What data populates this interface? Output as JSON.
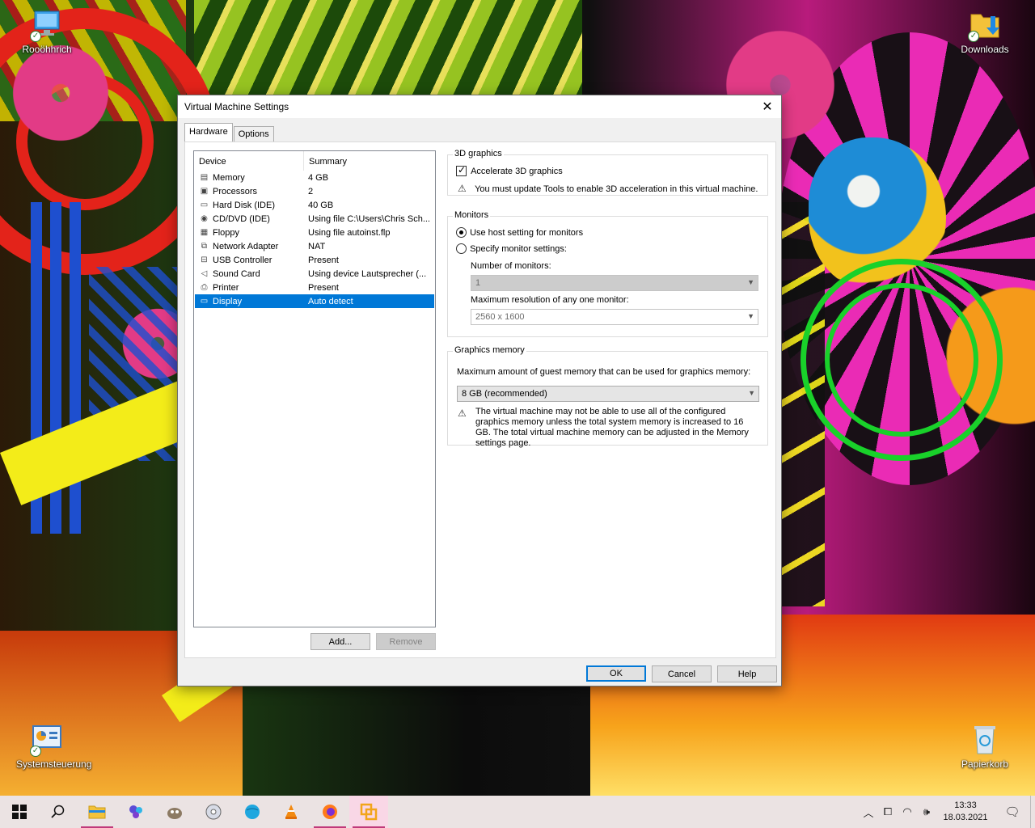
{
  "desktop": {
    "icons": [
      {
        "label": "Rooöhhrich",
        "icon": "computer-icon"
      },
      {
        "label": "Downloads",
        "icon": "downloads-folder-icon"
      },
      {
        "label": "Systemsteuerung",
        "icon": "control-panel-icon"
      },
      {
        "label": "Papierkorb",
        "icon": "recycle-bin-icon"
      }
    ]
  },
  "dialog": {
    "title": "Virtual Machine Settings",
    "tabs": [
      {
        "label": "Hardware"
      },
      {
        "label": "Options"
      }
    ],
    "device_list": {
      "col_device": "Device",
      "col_summary": "Summary",
      "rows": [
        {
          "device": "Memory",
          "summary": "4 GB",
          "icon": "memory-icon"
        },
        {
          "device": "Processors",
          "summary": "2",
          "icon": "processor-icon"
        },
        {
          "device": "Hard Disk (IDE)",
          "summary": "40 GB",
          "icon": "hard-disk-icon"
        },
        {
          "device": "CD/DVD (IDE)",
          "summary": "Using file C:\\Users\\Chris Sch...",
          "icon": "cd-dvd-icon"
        },
        {
          "device": "Floppy",
          "summary": "Using file autoinst.flp",
          "icon": "floppy-icon"
        },
        {
          "device": "Network Adapter",
          "summary": "NAT",
          "icon": "network-adapter-icon"
        },
        {
          "device": "USB Controller",
          "summary": "Present",
          "icon": "usb-controller-icon"
        },
        {
          "device": "Sound Card",
          "summary": "Using device Lautsprecher (...",
          "icon": "sound-card-icon"
        },
        {
          "device": "Printer",
          "summary": "Present",
          "icon": "printer-icon"
        },
        {
          "device": "Display",
          "summary": "Auto detect",
          "icon": "display-icon"
        }
      ],
      "selected": "Display"
    },
    "add_label": "Add...",
    "remove_label": "Remove",
    "graphics3d": {
      "legend": "3D graphics",
      "accelerate_label": "Accelerate 3D graphics",
      "accelerate_checked": true,
      "warning": "You must update Tools to enable 3D acceleration in this virtual machine."
    },
    "monitors": {
      "legend": "Monitors",
      "use_host_label": "Use host setting for monitors",
      "specify_label": "Specify monitor settings:",
      "selected_option": "use_host",
      "num_monitors_label": "Number of monitors:",
      "num_monitors_value": "1",
      "max_res_label": "Maximum resolution of any one monitor:",
      "max_res_value": "2560 x 1600"
    },
    "graphics_memory": {
      "legend": "Graphics memory",
      "label": "Maximum amount of guest memory that can be used for graphics memory:",
      "value": "8 GB (recommended)",
      "warning": "The virtual machine may not be able to use all of the configured graphics memory unless the total system memory is increased to 16 GB. The total virtual machine memory can be adjusted in the Memory settings page."
    },
    "ok_label": "OK",
    "cancel_label": "Cancel",
    "help_label": "Help"
  },
  "taskbar": {
    "apps": [
      {
        "name": "start-button",
        "icon": "windows-logo-icon"
      },
      {
        "name": "search-button",
        "icon": "search-icon"
      },
      {
        "name": "file-explorer",
        "icon": "folder-icon"
      },
      {
        "name": "app-chameleon",
        "icon": "chameleon-app-icon"
      },
      {
        "name": "app-gimp",
        "icon": "gimp-icon"
      },
      {
        "name": "app-disc",
        "icon": "disc-burner-icon"
      },
      {
        "name": "app-globe",
        "icon": "globe-icon"
      },
      {
        "name": "app-vlc",
        "icon": "vlc-icon"
      },
      {
        "name": "app-firefox",
        "icon": "firefox-icon"
      },
      {
        "name": "app-vmware",
        "icon": "vmware-icon"
      }
    ],
    "time": "13:33",
    "date": "18.03.2021"
  },
  "colors": {
    "selection": "#0078d7",
    "taskbar": "#ebe3e3",
    "taskbar_indicator": "#c0397a"
  }
}
